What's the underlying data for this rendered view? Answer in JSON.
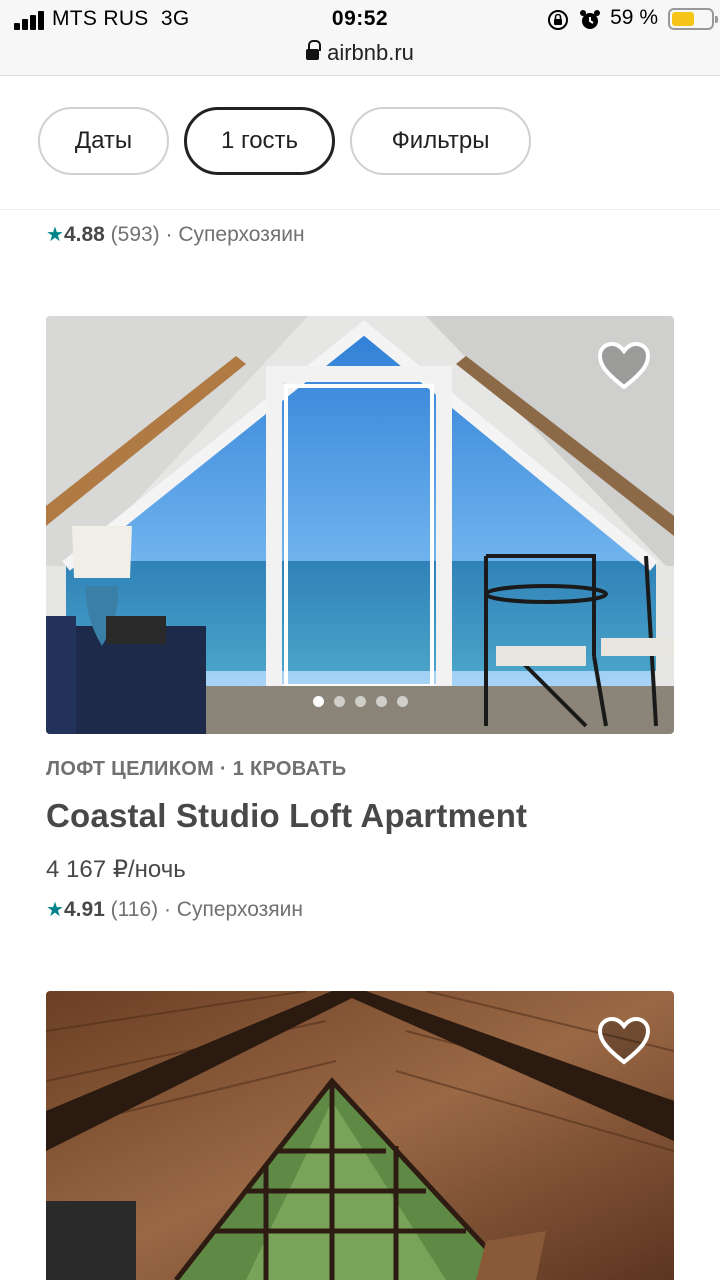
{
  "status_bar": {
    "carrier": "MTS RUS",
    "network": "3G",
    "time": "09:52",
    "battery_percent": "59 %",
    "battery_level": 0.59,
    "icons": [
      "signal-icon",
      "orientation-lock-icon",
      "alarm-icon",
      "battery-icon"
    ]
  },
  "browser": {
    "url": "airbnb.ru"
  },
  "filters": {
    "dates": "Даты",
    "guests": "1 гость",
    "more": "Фильтры"
  },
  "previous_listing": {
    "rating": "4.88",
    "reviews": "(593)",
    "host_badge": "· Суперхозяин"
  },
  "listings": [
    {
      "type": "ЛОФТ ЦЕЛИКОМ · 1 КРОВАТЬ",
      "title": "Coastal Studio Loft Apartment",
      "price": "4 167 ₽/ночь",
      "rating": "4.91",
      "reviews": "(116)",
      "host_badge": "· Суперхозяин",
      "photo_count": 5,
      "active_photo": 1
    },
    {
      "photo": "wooden-attic-photo"
    }
  ],
  "colors": {
    "accent_star": "#008489",
    "text_primary": "#484848",
    "text_secondary": "#717171",
    "active_border": "#222222"
  }
}
